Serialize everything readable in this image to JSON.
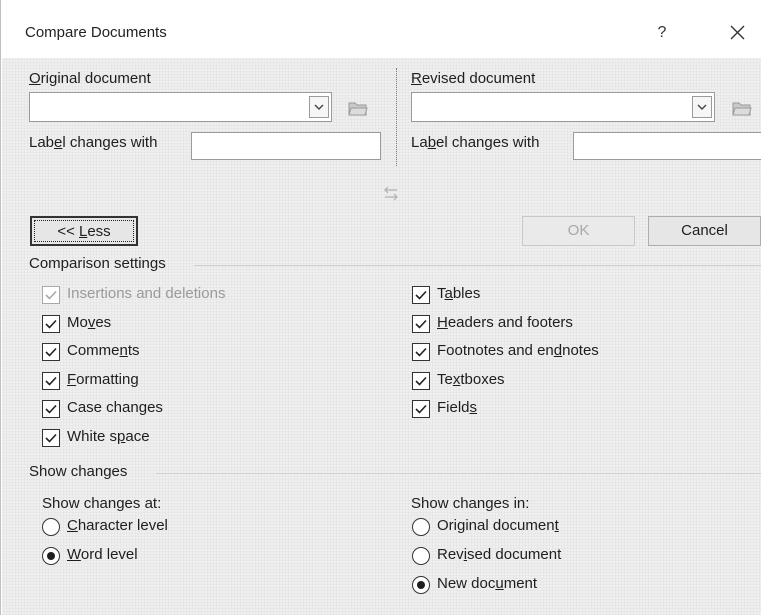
{
  "dialog": {
    "title": "Compare Documents",
    "help": "?",
    "close_icon": "close-x-icon"
  },
  "original": {
    "label": "Original document",
    "label_accel": "O",
    "label_rest": "riginal document",
    "value": "",
    "label_changes": {
      "pre": "Lab",
      "accel": "e",
      "post": "l changes with"
    },
    "label_changes_value": ""
  },
  "revised": {
    "label": "Revised document",
    "label_accel": "R",
    "label_rest": "evised document",
    "value": "",
    "label_changes": {
      "pre": "La",
      "accel": "b",
      "post": "el changes with"
    },
    "label_changes_value": ""
  },
  "swap_icon": "swap-arrows-icon",
  "buttons": {
    "less": {
      "pre": "<< ",
      "accel": "L",
      "post": "ess"
    },
    "ok": "OK",
    "cancel": "Cancel"
  },
  "comparison_settings": {
    "heading": "Comparison settings",
    "left": [
      {
        "pre": "",
        "accel": "",
        "post": "Insertions and deletions",
        "checked": true,
        "disabled": true
      },
      {
        "pre": "Mo",
        "accel": "v",
        "post": "es",
        "checked": true,
        "disabled": false
      },
      {
        "pre": "Comme",
        "accel": "n",
        "post": "ts",
        "checked": true,
        "disabled": false
      },
      {
        "pre": "",
        "accel": "F",
        "post": "ormatting",
        "checked": true,
        "disabled": false
      },
      {
        "pre": "Case chan",
        "accel": "g",
        "post": "es",
        "checked": true,
        "disabled": false
      },
      {
        "pre": "White s",
        "accel": "p",
        "post": "ace",
        "checked": true,
        "disabled": false
      }
    ],
    "right": [
      {
        "pre": "T",
        "accel": "a",
        "post": "bles",
        "checked": true,
        "disabled": false
      },
      {
        "pre": "",
        "accel": "H",
        "post": "eaders and footers",
        "checked": true,
        "disabled": false
      },
      {
        "pre": "Footnotes and en",
        "accel": "d",
        "post": "notes",
        "checked": true,
        "disabled": false
      },
      {
        "pre": "Te",
        "accel": "x",
        "post": "tboxes",
        "checked": true,
        "disabled": false
      },
      {
        "pre": "Field",
        "accel": "s",
        "post": "",
        "checked": true,
        "disabled": false
      }
    ]
  },
  "show_changes": {
    "heading": "Show changes",
    "at_label": "Show changes at:",
    "at_options": [
      {
        "pre": "",
        "accel": "C",
        "post": "haracter level",
        "selected": false
      },
      {
        "pre": "",
        "accel": "W",
        "post": "ord level",
        "selected": true
      }
    ],
    "in_label": "Show changes in:",
    "in_options": [
      {
        "pre": "Original documen",
        "accel": "t",
        "post": "",
        "selected": false
      },
      {
        "pre": "Rev",
        "accel": "i",
        "post": "sed document",
        "selected": false
      },
      {
        "pre": "New doc",
        "accel": "u",
        "post": "ment",
        "selected": true
      }
    ]
  }
}
